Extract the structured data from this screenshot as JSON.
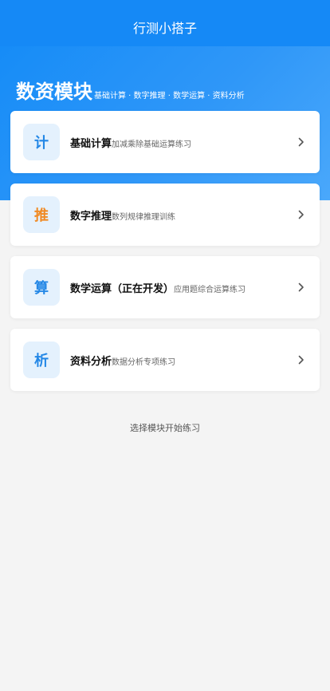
{
  "nav": {
    "title": "行测小搭子"
  },
  "hero": {
    "title": "数资模块",
    "subtitle": "基础计算 · 数字推理 · 数学运算 · 资料分析"
  },
  "modules": [
    {
      "icon_char": "计",
      "name": "基础计算",
      "desc": "加减乘除基础运算练习",
      "icon_color": "#2387e6"
    },
    {
      "icon_char": "推",
      "name": "数字推理",
      "desc": "数列规律推理训练",
      "icon_color": "#f08a24"
    },
    {
      "icon_char": "算",
      "name": "数学运算（正在开发）",
      "desc": "应用题综合运算练习",
      "icon_color": "#2387e6"
    },
    {
      "icon_char": "析",
      "name": "资料分析",
      "desc": "数据分析专项练习",
      "icon_color": "#2387e6"
    }
  ],
  "footer": {
    "hint": "选择模块开始练习"
  },
  "colors": {
    "nav_bg": "#1589f6",
    "hero_gradient_start": "#168cf7",
    "hero_gradient_end": "#4aa8fb",
    "page_bg": "#f4f4f4",
    "icon_bg": "#e4f1fd"
  }
}
